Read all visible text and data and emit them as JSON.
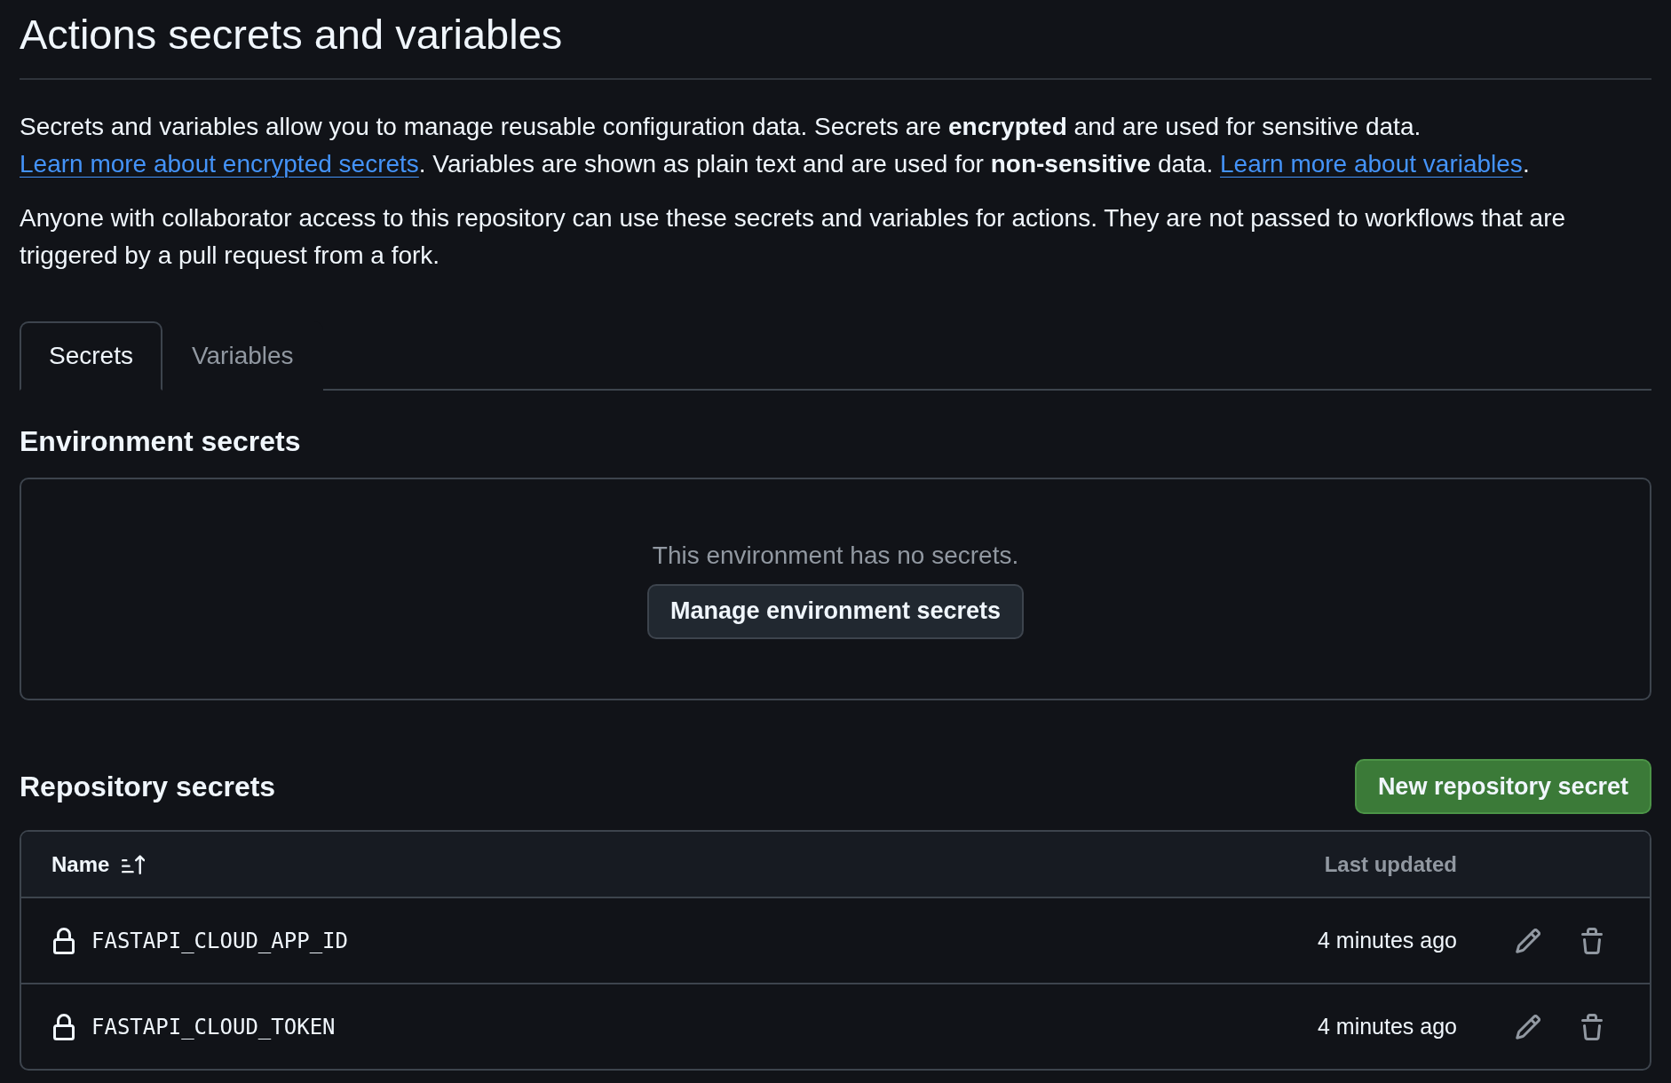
{
  "page": {
    "title": "Actions secrets and variables"
  },
  "intro": [
    {
      "segments": [
        {
          "kind": "text",
          "text": "Secrets and variables allow you to manage reusable configuration data. Secrets are **encrypted** and are used for sensitive data. "
        },
        {
          "kind": "link",
          "text": "Learn more about encrypted secrets"
        },
        {
          "kind": "text",
          "text": ". Variables are shown as plain text and are used for **non-sensitive** data. "
        },
        {
          "kind": "link",
          "text": "Learn more about variables"
        },
        {
          "kind": "text",
          "text": "."
        }
      ]
    },
    {
      "segments": [
        {
          "kind": "text",
          "text": "Anyone with collaborator access to this repository can use these secrets and variables for actions. They are not passed to workflows that are triggered by a pull request from a fork."
        }
      ]
    }
  ],
  "tabs": [
    {
      "label": "Secrets",
      "selected": true
    },
    {
      "label": "Variables",
      "selected": false
    }
  ],
  "environment_secrets": {
    "heading": "Environment secrets",
    "empty_message": "This environment has no secrets.",
    "button": "Manage environment secrets"
  },
  "repository_secrets": {
    "heading": "Repository secrets",
    "new_button": "New repository secret",
    "table": {
      "columns": [
        {
          "label": "Name",
          "sorted": true,
          "descending": false
        },
        {
          "label": "Last updated"
        }
      ],
      "rows": [
        {
          "name": "FASTAPI_CLOUD_APP_ID",
          "updated": "4 minutes ago"
        },
        {
          "name": "FASTAPI_CLOUD_TOKEN",
          "updated": "4 minutes ago"
        }
      ]
    }
  }
}
